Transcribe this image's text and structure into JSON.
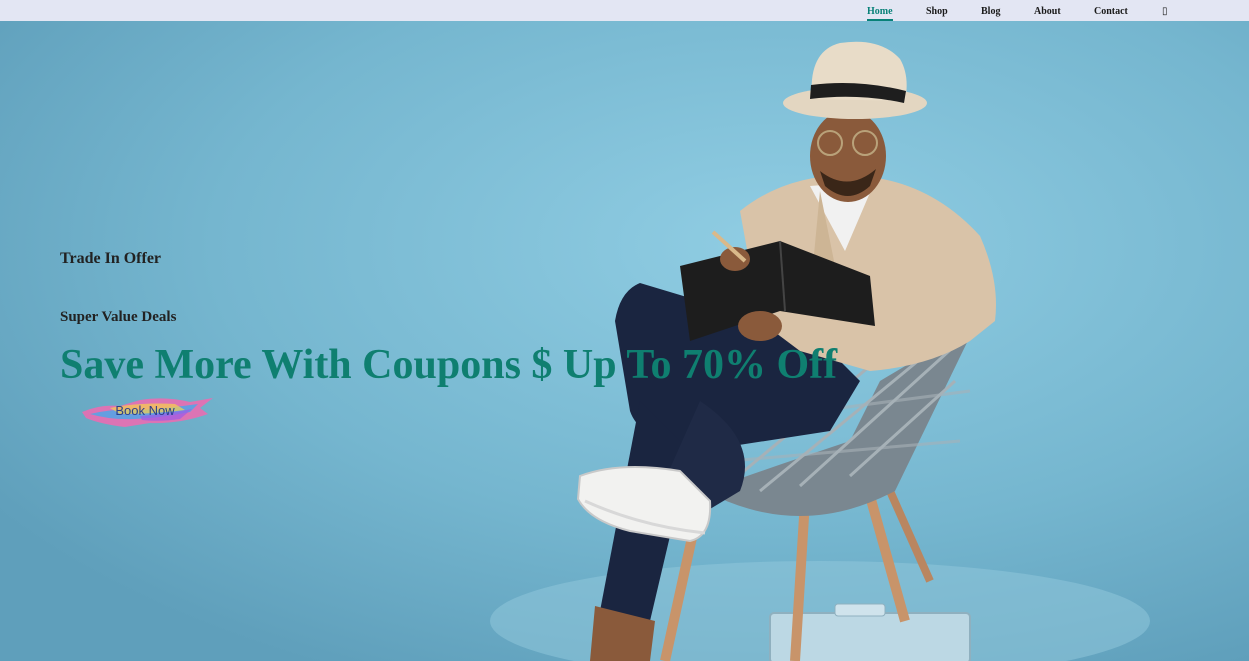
{
  "nav": {
    "items": [
      {
        "label": "Home",
        "active": true
      },
      {
        "label": "Shop"
      },
      {
        "label": "Blog"
      },
      {
        "label": "About"
      },
      {
        "label": "Contact"
      }
    ],
    "bag_glyph": "▯",
    "bag_icon": "shopping-bag-icon"
  },
  "hero": {
    "eyebrow": "Trade In Offer",
    "subhead": "Super Value Deals",
    "headline": "Save More With Coupons $ Up To 70% Off",
    "cta_label": "Book Now"
  },
  "colors": {
    "nav_bg": "#e3e6f3",
    "accent": "#088178",
    "headline": "#0f7f70",
    "hero_bg": "#7ab9d2"
  }
}
